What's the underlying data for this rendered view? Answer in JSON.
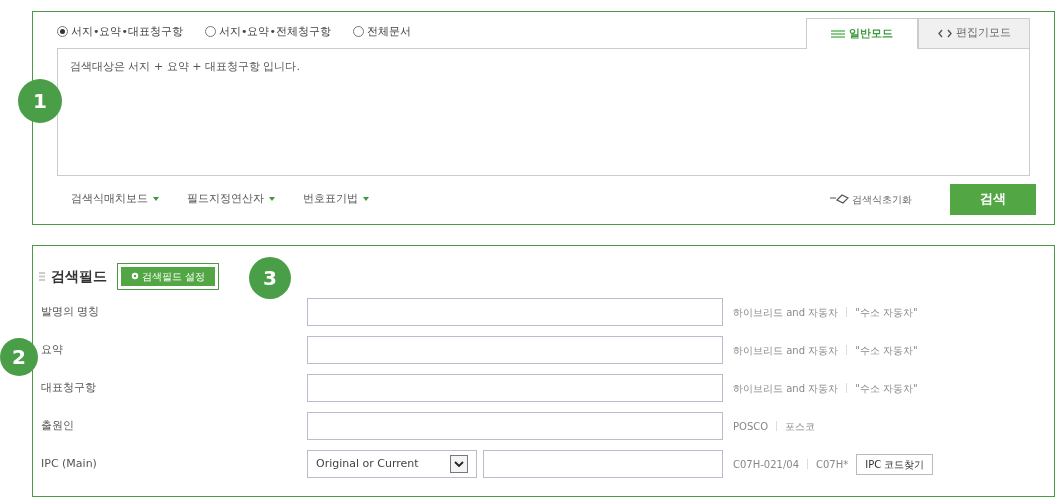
{
  "query": {
    "scopes": [
      {
        "label": "서지•요약•대표청구항",
        "selected": true
      },
      {
        "label": "서지•요약•전체청구항",
        "selected": false
      },
      {
        "label": "전체문서",
        "selected": false
      }
    ],
    "tabs": [
      {
        "label": "일반모드",
        "kind": "list",
        "selected": true
      },
      {
        "label": "편집기모드",
        "kind": "code",
        "selected": false
      }
    ],
    "editor_text": "검색대상은 서지 + 요약 + 대표청구항 입니다.",
    "menus": [
      "검색식매치보드",
      "필드지정연산자",
      "번호표기법"
    ],
    "reset_label": "검색식초기화",
    "search_button": "검색"
  },
  "fields": {
    "title": "검색필드",
    "settings_button": "검색필드 설정",
    "rows": [
      {
        "label": "발명의 명칭",
        "kind": "text",
        "hints": [
          "하이브리드 and 자동차",
          "\"수소 자동차\""
        ]
      },
      {
        "label": "요약",
        "kind": "text",
        "hints": [
          "하이브리드 and 자동차",
          "\"수소 자동차\""
        ]
      },
      {
        "label": "대표청구항",
        "kind": "text",
        "hints": [
          "하이브리드 and 자동차",
          "\"수소 자동차\""
        ]
      },
      {
        "label": "출원인",
        "kind": "text",
        "hints": [
          "POSCO",
          "포스코"
        ]
      },
      {
        "label": "IPC (Main)",
        "kind": "select",
        "select_value": "Original or Current",
        "hints": [
          "C07H-021/04",
          "C07H*"
        ],
        "button": "IPC 코드찾기"
      }
    ]
  },
  "badges": [
    "1",
    "2",
    "3"
  ]
}
